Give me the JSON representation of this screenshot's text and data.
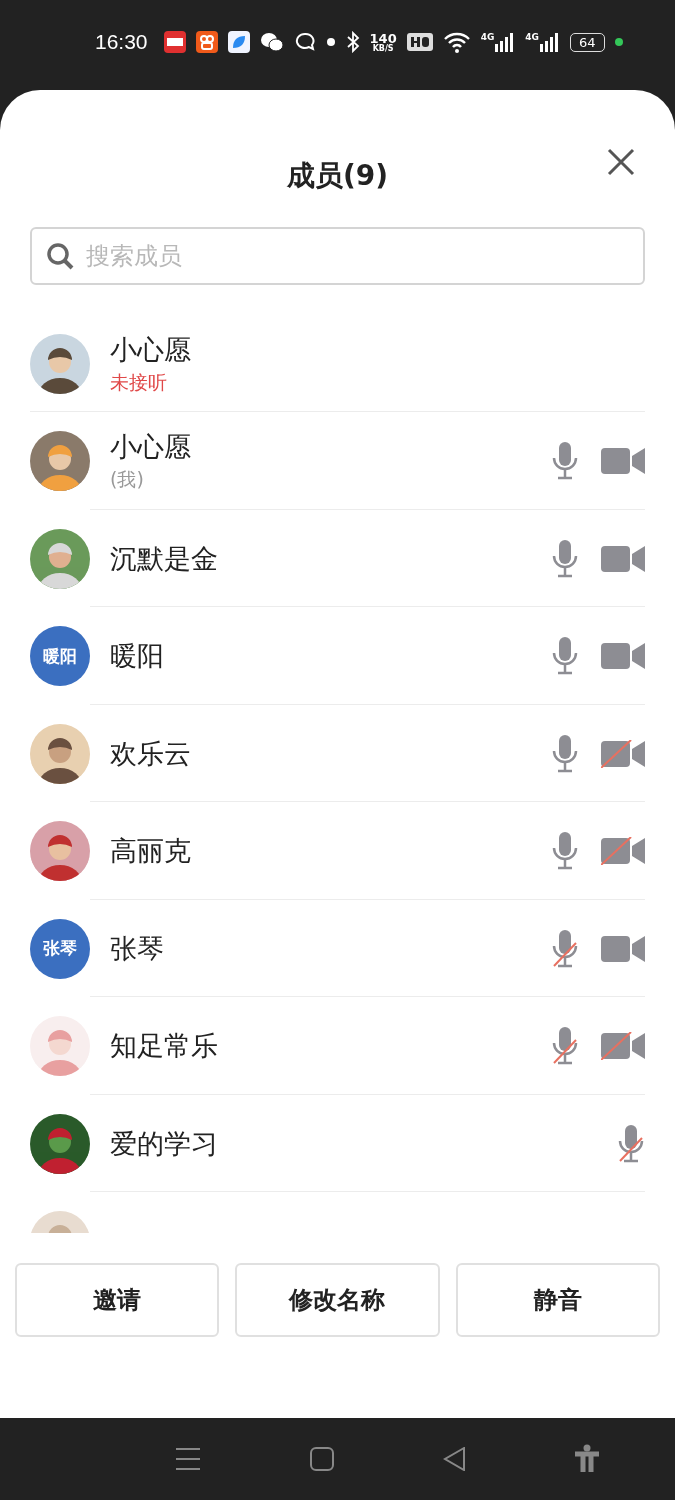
{
  "status_bar": {
    "time": "16:30",
    "speed": "140",
    "speed_unit": "KB/S",
    "network_labels": [
      "4G",
      "4G"
    ],
    "battery": "64"
  },
  "sheet": {
    "title": "成员(9)",
    "search": {
      "placeholder": "搜索成员"
    },
    "members": [
      {
        "name": "小心愿",
        "avatar": {
          "kind": "picture"
        },
        "status": {
          "kind": "missed",
          "text": "未接听"
        }
      },
      {
        "name": "小心愿",
        "avatar": {
          "kind": "picture"
        },
        "status": {
          "kind": "self",
          "text": "(我)"
        },
        "mic_muted": false,
        "camera_muted": false
      },
      {
        "name": "沉默是金",
        "avatar": {
          "kind": "picture"
        },
        "mic_muted": false,
        "camera_muted": false
      },
      {
        "name": "暖阳",
        "avatar": {
          "kind": "initials",
          "text": "暖阳",
          "color": "#3b6fc0"
        },
        "mic_muted": false,
        "camera_muted": false
      },
      {
        "name": "欢乐云",
        "avatar": {
          "kind": "picture"
        },
        "mic_muted": false,
        "camera_muted": true
      },
      {
        "name": "高丽克",
        "avatar": {
          "kind": "picture"
        },
        "mic_muted": false,
        "camera_muted": true
      },
      {
        "name": "张琴",
        "avatar": {
          "kind": "initials",
          "text": "张琴",
          "color": "#3b6fc0"
        },
        "mic_muted": true,
        "camera_muted": false
      },
      {
        "name": "知足常乐",
        "avatar": {
          "kind": "picture"
        },
        "mic_muted": true,
        "camera_muted": true
      },
      {
        "name": "爱的学习",
        "avatar": {
          "kind": "picture"
        },
        "mic_muted": true
      },
      {
        "avatar": {
          "kind": "picture"
        }
      }
    ],
    "buttons": [
      "邀请",
      "修改名称",
      "静音"
    ]
  }
}
